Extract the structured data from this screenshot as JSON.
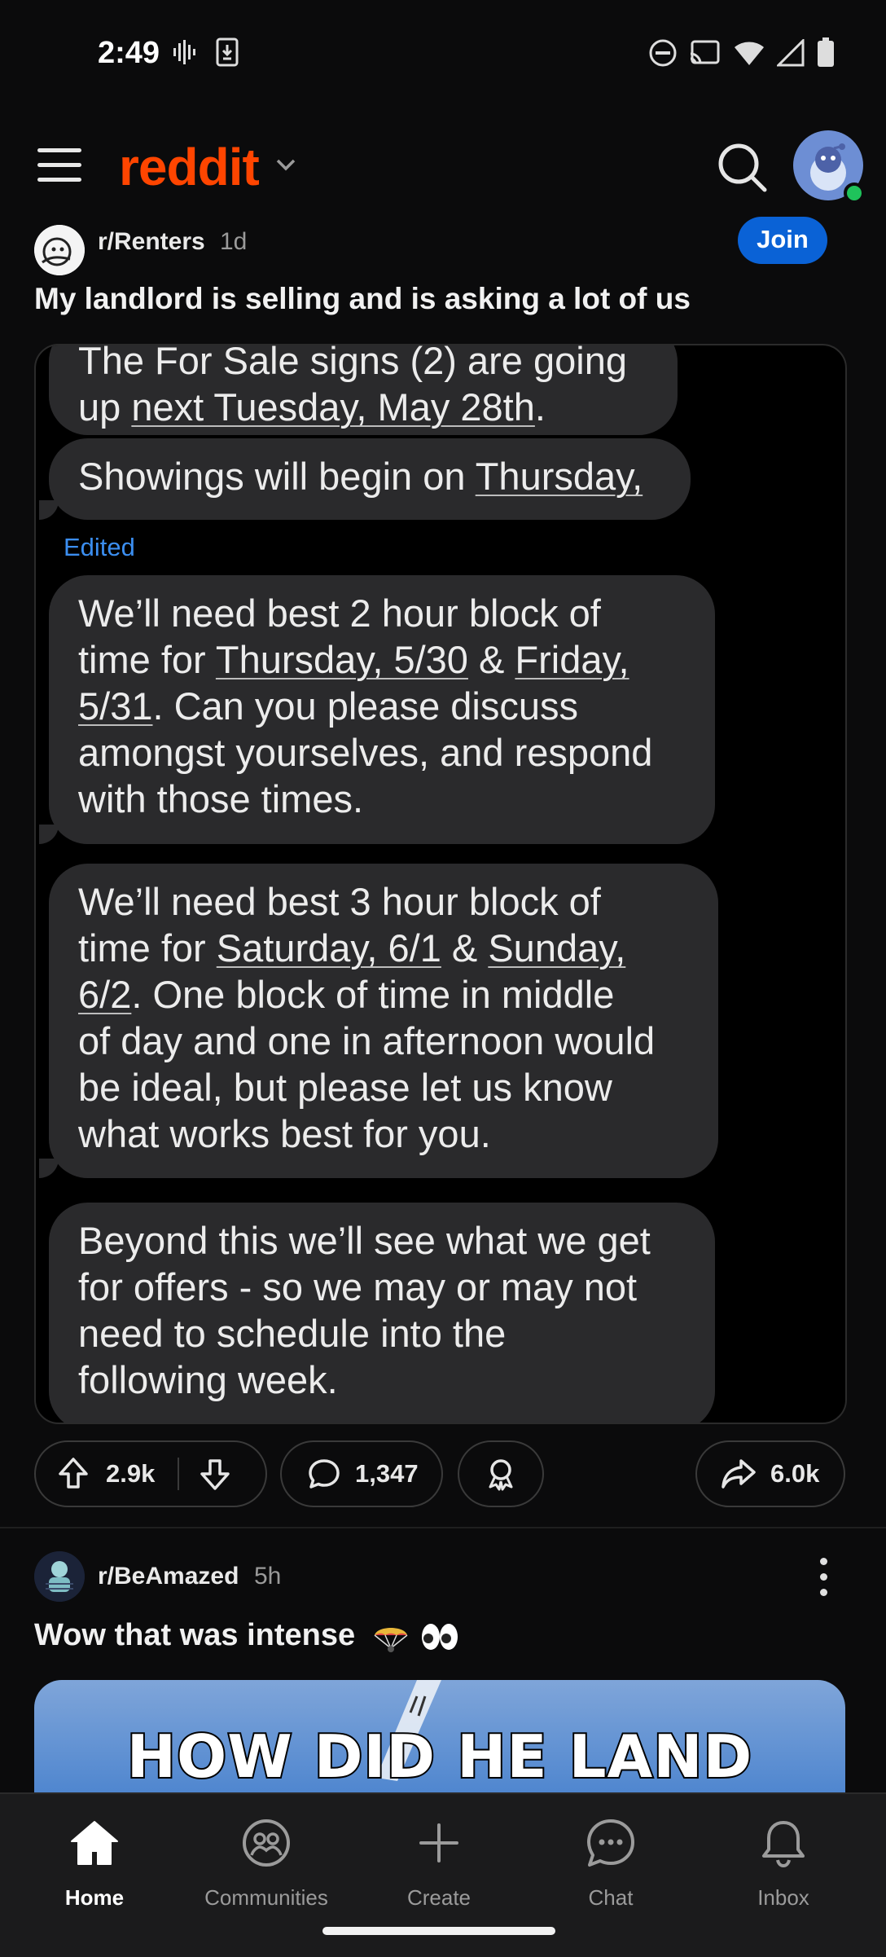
{
  "status_bar": {
    "time": "2:49"
  },
  "header": {
    "logo": "reddit"
  },
  "post1": {
    "subreddit": "r/Renters",
    "age": "1d",
    "join_label": "Join",
    "title": "My landlord is selling and is asking a lot of us",
    "bubbles": [
      {
        "line1": "The For Sale signs (2) are going",
        "line2_pre": "up ",
        "line2_link": "next Tuesday, May 28th",
        "line2_post": "."
      },
      {
        "pre": "Showings will begin on ",
        "link": "Thursday,"
      },
      {
        "a": "We’ll need best 2 hour block of",
        "b_pre": "time for ",
        "b_link1": "Thursday, 5/30",
        "b_mid": " & ",
        "b_link2": "Friday,",
        "c_link": "5/31",
        "c_post": ".  Can you please discuss",
        "d": "amongst yourselves, and respond",
        "e": "with those times."
      },
      {
        "a": "We’ll need best 3 hour block of",
        "b_pre": "time for ",
        "b_link1": "Saturday, 6/1",
        "b_mid": " & ",
        "b_link2": "Sunday,",
        "c_link": "6/2",
        "c_post": ".  One block of time in middle",
        "d": "of day and one in afternoon would",
        "e": "be ideal, but please let us know",
        "f": "what works best for you."
      },
      {
        "a": "Beyond this we’ll see what we get",
        "b": "for offers - so we may or may not",
        "c": "need to schedule into the",
        "d": "following week."
      }
    ],
    "edited_label": "Edited",
    "upvotes": "2.9k",
    "comments": "1,347",
    "shares": "6.0k"
  },
  "post2": {
    "subreddit": "r/BeAmazed",
    "age": "5h",
    "title": "Wow that was intense",
    "media_text": "HOW DID HE LAND"
  },
  "nav": {
    "home": "Home",
    "communities": "Communities",
    "create": "Create",
    "chat": "Chat",
    "inbox": "Inbox"
  },
  "colors": {
    "brand": "#ff4500",
    "join": "#0a62d6",
    "edited": "#3b8ef0"
  }
}
